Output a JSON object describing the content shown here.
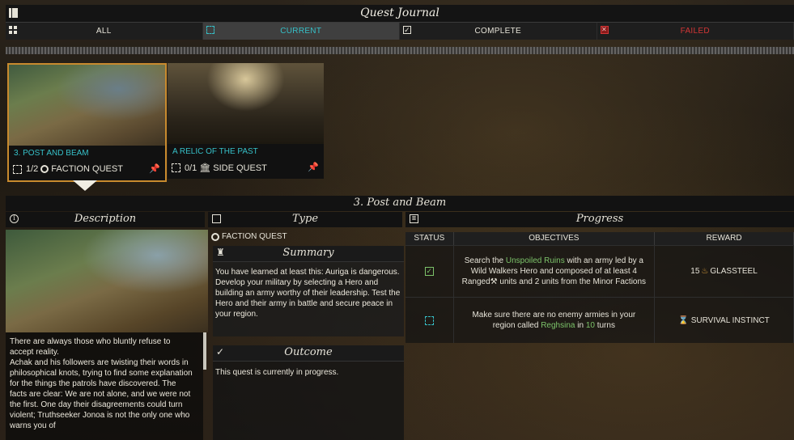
{
  "window": {
    "title": "Quest Journal"
  },
  "tabs": [
    {
      "label": "ALL",
      "state": "normal"
    },
    {
      "label": "CURRENT",
      "state": "active"
    },
    {
      "label": "COMPLETE",
      "state": "normal"
    },
    {
      "label": "FAILED",
      "state": "failed"
    }
  ],
  "quests": [
    {
      "title": "3. POST AND BEAM",
      "progress": "1/2",
      "type": "FACTION QUEST",
      "pinned": true,
      "selected": true
    },
    {
      "title": "A RELIC OF THE PAST",
      "progress": "0/1",
      "type": "SIDE QUEST",
      "pinned": true,
      "selected": false
    }
  ],
  "detail": {
    "title": "3. Post and Beam",
    "columns": {
      "description": "Description",
      "type": "Type",
      "progress": "Progress"
    },
    "description_text": [
      "There are always those who bluntly refuse to accept reality.",
      "Achak and his followers are twisting their words in philosophical knots, trying to find some explanation for the things the patrols have discovered. The facts are clear: We are not alone, and we were not the first. One day their disagreements could turn violent; Truthseeker Jonoa is not the only one who warns you of"
    ],
    "quest_type": "FACTION QUEST",
    "summary": {
      "heading": "Summary",
      "text": "You have learned at least this: Auriga is dangerous. Develop your military by selecting a Hero and building an army worthy of their leadership. Test the Hero and their army in battle and secure peace in your region."
    },
    "outcome": {
      "heading": "Outcome",
      "text": "This quest is currently in progress."
    },
    "progress_table": {
      "headers": [
        "STATUS",
        "OBJECTIVES",
        "REWARD"
      ],
      "rows": [
        {
          "status": "complete",
          "objective_pre": "Search the ",
          "objective_link": "Unspoiled Ruins",
          "objective_post": " with an army led by a Wild Walkers Hero and composed of at least 4 Ranged",
          "objective_post2": " units and 2 units from the Minor Factions",
          "reward_amount": "15",
          "reward_name": "GLASSTEEL"
        },
        {
          "status": "in-progress",
          "objective_pre": "Make sure there are no enemy armies in your region called ",
          "objective_link": "Reghsina",
          "objective_mid": " in ",
          "objective_num": "10",
          "objective_post": " turns",
          "reward_name": "SURVIVAL INSTINCT"
        }
      ]
    }
  },
  "colors": {
    "accent": "#36c0c8",
    "selection": "#c88a2e",
    "failed": "#d23636",
    "link_green": "#7cc36a"
  }
}
